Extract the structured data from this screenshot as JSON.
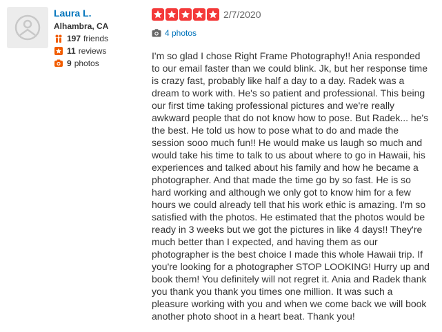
{
  "user": {
    "name": "Laura L.",
    "location": "Alhambra, CA",
    "friends_count": "197",
    "friends_label": "friends",
    "reviews_count": "11",
    "reviews_label": "reviews",
    "photos_count": "9",
    "photos_label": "photos"
  },
  "review": {
    "rating": 5,
    "date": "2/7/2020",
    "photos_link": "4 photos",
    "text": "I'm so glad I chose Right Frame Photography!! Ania responded to our email faster than we could blink. Jk, but her response time is crazy fast, probably like half a day to a day.  Radek was a dream to work with. He's so patient and professional. This being our first time taking professional pictures and we're really awkward people that do not know how to pose. But Radek... he's the best. He told us how to pose what to do and made the session sooo much fun!! He would make us laugh so much and would take his time to talk to us about where to go in Hawaii, his experiences and talked about his family and how he became a photographer. And that made the time go by so fast. He is so hard working and although we only got to know him for a few hours we could already tell that his work ethic is amazing. I'm so satisfied with the photos. He estimated that the photos would be ready in 3 weeks but we got the pictures in like 4 days!! They're much better than I expected, and having them as our photographer is the best choice I made this whole Hawaii trip. If you're looking for a photographer STOP LOOKING! Hurry up and book them! You definitely will not regret it. Ania and Radek thank you thank you thank you times one million. It was such a pleasure working with you and when we come back we will book another photo shoot in a heart beat. Thank you!"
  },
  "colors": {
    "link": "#0073bb",
    "star": "#f43939",
    "friends_icon": "#f15c00",
    "reviews_icon": "#f15c00",
    "photos_icon": "#f15c00"
  },
  "icons": {
    "avatar": "default-user-icon",
    "friends": "friends-icon",
    "reviews": "star-badge-icon",
    "photos": "camera-icon",
    "review_photos": "camera-icon"
  }
}
